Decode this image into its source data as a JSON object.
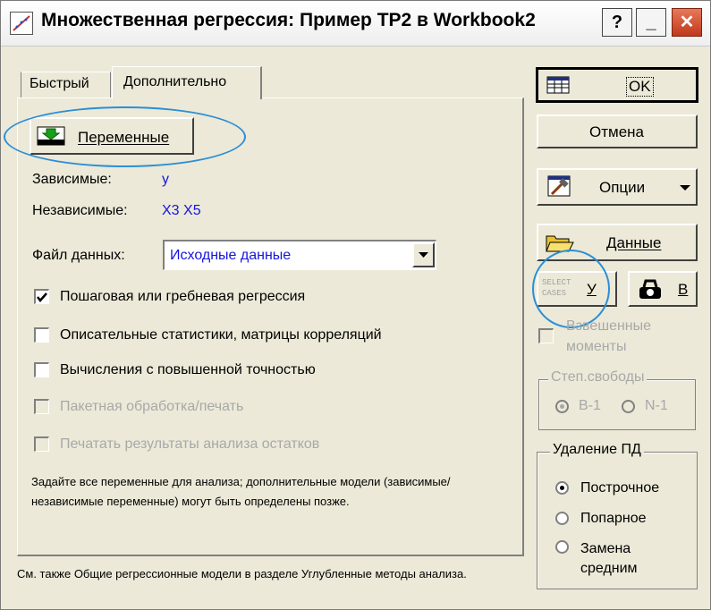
{
  "window": {
    "title": "Множественная регрессия: Пример ТР2 в Workbook2"
  },
  "titlebar_buttons": {
    "help": "?",
    "minimize": "_",
    "close": "✕"
  },
  "tabs": [
    {
      "label": "Быстрый"
    },
    {
      "label": "Дополнительно"
    }
  ],
  "variables_button": "Переменные",
  "dependent": {
    "label": "Зависимые:",
    "value": "y"
  },
  "independent": {
    "label": "Независимые:",
    "value": "X3 X5"
  },
  "data_file": {
    "label": "Файл данных:",
    "value": "Исходные данные"
  },
  "checkboxes": [
    {
      "label": "Пошаговая или гребневая регрессия",
      "checked": true,
      "enabled": true
    },
    {
      "label": "Описательные статистики, матрицы корреляций",
      "checked": false,
      "enabled": true
    },
    {
      "label": "Вычисления с повышенной точностью",
      "checked": false,
      "enabled": true
    },
    {
      "label": "Пакетная обработка/печать",
      "checked": false,
      "enabled": false
    },
    {
      "label": "Печатать результаты анализа остатков",
      "checked": false,
      "enabled": false
    }
  ],
  "hint_text": "Задайте все переменные для анализа; дополнительные модели (зависимые/независимые переменные) могут быть определены позже.",
  "footer_text": "См. также Общие регрессионные модели в разделе Углубленные методы анализа.",
  "right_buttons": {
    "ok": "OK",
    "cancel": "Отмена",
    "options": "Опции",
    "data": "Данные",
    "select_cases_icon_text": "SELECT CASES",
    "select_cases_letter": "У",
    "weight_letter": "В"
  },
  "weighted_moments": {
    "label_line1": "Взвешенные",
    "label_line2": "моменты"
  },
  "dof_group": {
    "label": "Степ.свободы",
    "options": [
      "В-1",
      "N-1"
    ]
  },
  "md_group": {
    "label": "Удаление ПД",
    "options": [
      "Построчное",
      "Попарное",
      "Замена средним"
    ],
    "selected": "Построчное"
  },
  "colors": {
    "accent_blue": "#1515e0",
    "highlight_oval": "#2b8fd6"
  }
}
